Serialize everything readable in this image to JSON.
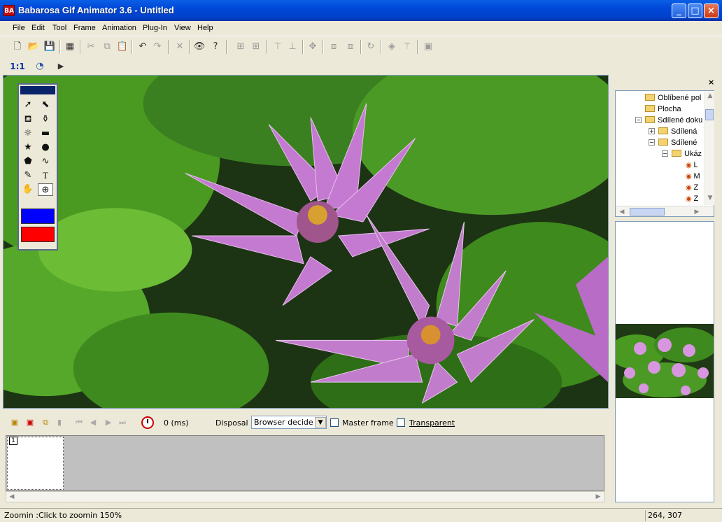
{
  "window": {
    "title": "Babarosa Gif Animator 3.6 - Untitled",
    "logo_text": "BA"
  },
  "window_controls": {
    "minimize": "_",
    "maximize": "□",
    "close": "×"
  },
  "menu": [
    "File",
    "Edit",
    "Tool",
    "Frame",
    "Animation",
    "Plug-In",
    "View",
    "Help"
  ],
  "toolbar": {
    "icons": [
      "new-icon",
      "open-icon",
      "save-icon",
      "preview-gif-icon",
      "cut-icon",
      "copy-icon",
      "paste-icon",
      "undo-icon",
      "redo-icon",
      "delete-icon",
      "eye-icon",
      "help-icon",
      "align-left-icon",
      "align-right-icon",
      "align-top-icon",
      "align-bottom-icon",
      "move-icon",
      "frame-copy-icon",
      "frame-paste-icon",
      "rotate-icon",
      "effect-icon",
      "wand-icon",
      "layer-icon"
    ]
  },
  "toolbar2": {
    "zoom_label": "1:1"
  },
  "palette": {
    "fg_color": "#0000ff",
    "bg_color": "#ff0000"
  },
  "frame_panel": {
    "delay_value": "0 (ms)",
    "disposal_label": "Disposal",
    "disposal_value": "Browser decide",
    "master_frame_label": "Master frame",
    "transparent_label": "Transparent",
    "frame_number": "1"
  },
  "tree": {
    "items": [
      {
        "label": "Oblíbené pol"
      },
      {
        "label": "Plocha"
      },
      {
        "label": "Sdílené doku"
      },
      {
        "label": "Sdílená"
      },
      {
        "label": "Sdílené"
      },
      {
        "label": "Ukáz"
      },
      {
        "label": "L"
      },
      {
        "label": "M"
      },
      {
        "label": "Z"
      },
      {
        "label": "Z"
      }
    ]
  },
  "status": {
    "message": "Zoomin :Click to zoomin 150%",
    "coords": "264, 307"
  }
}
